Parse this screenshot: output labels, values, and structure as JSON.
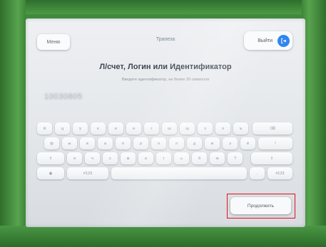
{
  "header": {
    "menu_label": "Меню",
    "title": "Трапеза",
    "exit_label": "Выйти"
  },
  "main": {
    "heading": "Л/счет, Логин или Идентификатор",
    "hint": "Введите идентификатор, не более 20 символов",
    "input_value": "10030805"
  },
  "keyboard": {
    "row1": [
      "й",
      "ц",
      "у",
      "к",
      "е",
      "н",
      "г",
      "ш",
      "щ",
      "з",
      "х",
      "ъ",
      "⌫"
    ],
    "row2": [
      "ф",
      "ы",
      "в",
      "а",
      "п",
      "р",
      "о",
      "л",
      "д",
      "ж",
      "э",
      "ё",
      "!"
    ],
    "row3": [
      "⇧",
      "я",
      "ч",
      "с",
      "м",
      "и",
      "т",
      "ь",
      "б",
      "ю",
      "?",
      "⇧"
    ],
    "row4": [
      "◉",
      "#123",
      "",
      "",
      "",
      ".",
      "#123"
    ]
  },
  "footer": {
    "continue_label": "Продолжить"
  },
  "colors": {
    "accent": "#2f86f0",
    "highlight": "#e0101e",
    "bezel": "#3f8a3c"
  },
  "icons": {
    "exit": "logout-icon",
    "backspace": "backspace-icon",
    "shift": "shift-icon",
    "globe": "language-icon"
  }
}
